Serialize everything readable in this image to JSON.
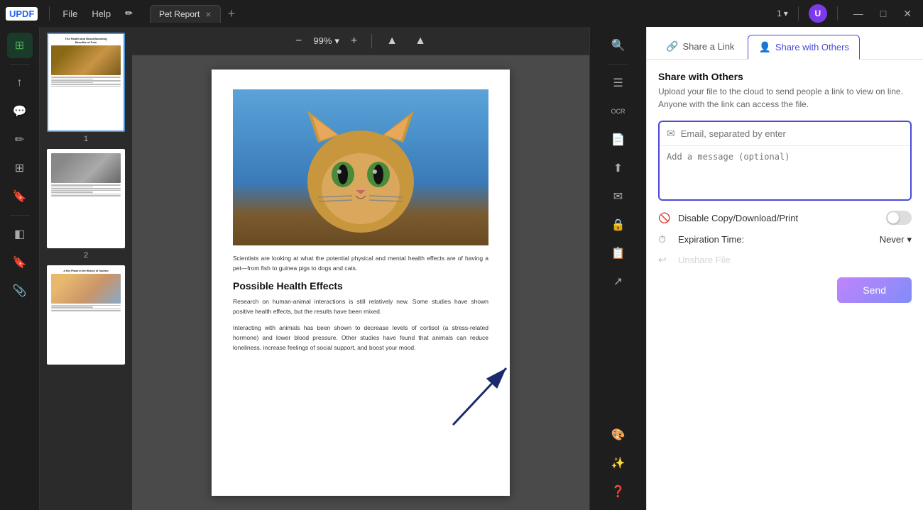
{
  "app": {
    "logo": "UPDF",
    "title": "Pet Report",
    "tab_close": "×",
    "tab_add": "+",
    "page_indicator": "1",
    "user_initial": "U"
  },
  "titlebar": {
    "menus": [
      "File",
      "Help"
    ],
    "win_min": "—",
    "win_max": "□",
    "win_close": "✕"
  },
  "sidebar": {
    "icons": [
      "⊞",
      "↑",
      "≡",
      "⊟",
      "✎",
      "⊠",
      "⋯"
    ]
  },
  "toolbar": {
    "zoom_out": "−",
    "zoom_level": "99%",
    "zoom_in": "+",
    "nav_up": "▲",
    "nav_all": "▲"
  },
  "thumbnails": [
    {
      "label": "1",
      "title": "The Health and Mood-Boosting\nBenefits of Pets"
    },
    {
      "label": "2"
    },
    {
      "label": "",
      "subtitle": "A Key Phase in the History of Tourism"
    }
  ],
  "document": {
    "body1": "Scientists are looking at what the potential physical and mental health effects are of having a pet—from fish to guinea pigs to dogs and cats.",
    "heading1": "Possible Health Effects",
    "body2": "Research on human-animal interactions is still relatively new. Some studies have shown positive health effects, but the results have been mixed.",
    "body3": "Interacting with animals has been shown to decrease levels of cortisol (a stress-related hormone) and lower blood pressure. Other studies have found that animals can reduce loneliness, increase feelings of social support, and boost your mood."
  },
  "share_panel": {
    "tab1_label": "Share a Link",
    "tab1_icon": "🔗",
    "tab2_label": "Share with Others",
    "tab2_icon": "👤",
    "active_tab": "tab2",
    "title": "Share with Others",
    "description": "Upload your file to the cloud to send people a link to view on line. Anyone with the link can access the file.",
    "email_placeholder": "Email, separated by enter",
    "message_placeholder": "Add a message (optional)",
    "disable_option": "Disable Copy/Download/Print",
    "expiry_label": "Expiration Time:",
    "expiry_value": "Never",
    "unshare_label": "Unshare File",
    "send_label": "Send"
  },
  "right_sidebar": {
    "icons": [
      "🔍",
      "≡",
      "📄",
      "⬆",
      "✉",
      "📋",
      "🔒",
      "⚙",
      "🎨",
      "📎"
    ]
  }
}
